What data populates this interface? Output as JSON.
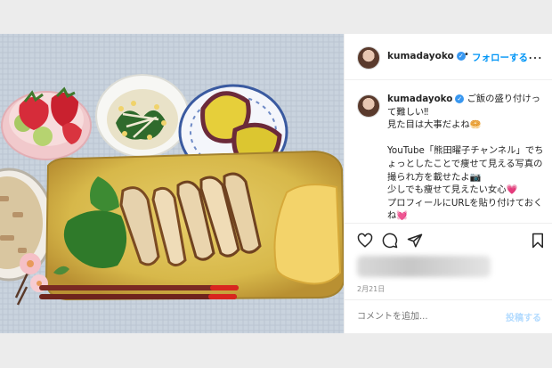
{
  "header": {
    "username": "kumadayoko",
    "dot": "•",
    "follow_label": "フォローする",
    "more": "…"
  },
  "caption": {
    "username": "kumadayoko",
    "text": "ご飯の盛り付けって難しい‼︎\n見た目は大事だよね🥯\n\nYouTube「熊田曜子チャンネル」でちょっとしたことで痩せて見える写真の撮られ方を載せたよ📷\n少しでも痩せて見えたい女心💗\nプロフィールにURLを貼り付けておくね💓"
  },
  "post": {
    "date": "2月21日"
  },
  "comment": {
    "placeholder": "コメントを追加...",
    "post_label": "投稿する"
  },
  "icons": {
    "verified": "verified-badge-icon",
    "like": "heart-icon",
    "comment": "comment-bubble-icon",
    "share": "paper-plane-icon",
    "save": "bookmark-icon"
  },
  "colors": {
    "accent": "#0095f6",
    "verified": "#3897f0",
    "post_disabled": "#b3dbff"
  }
}
